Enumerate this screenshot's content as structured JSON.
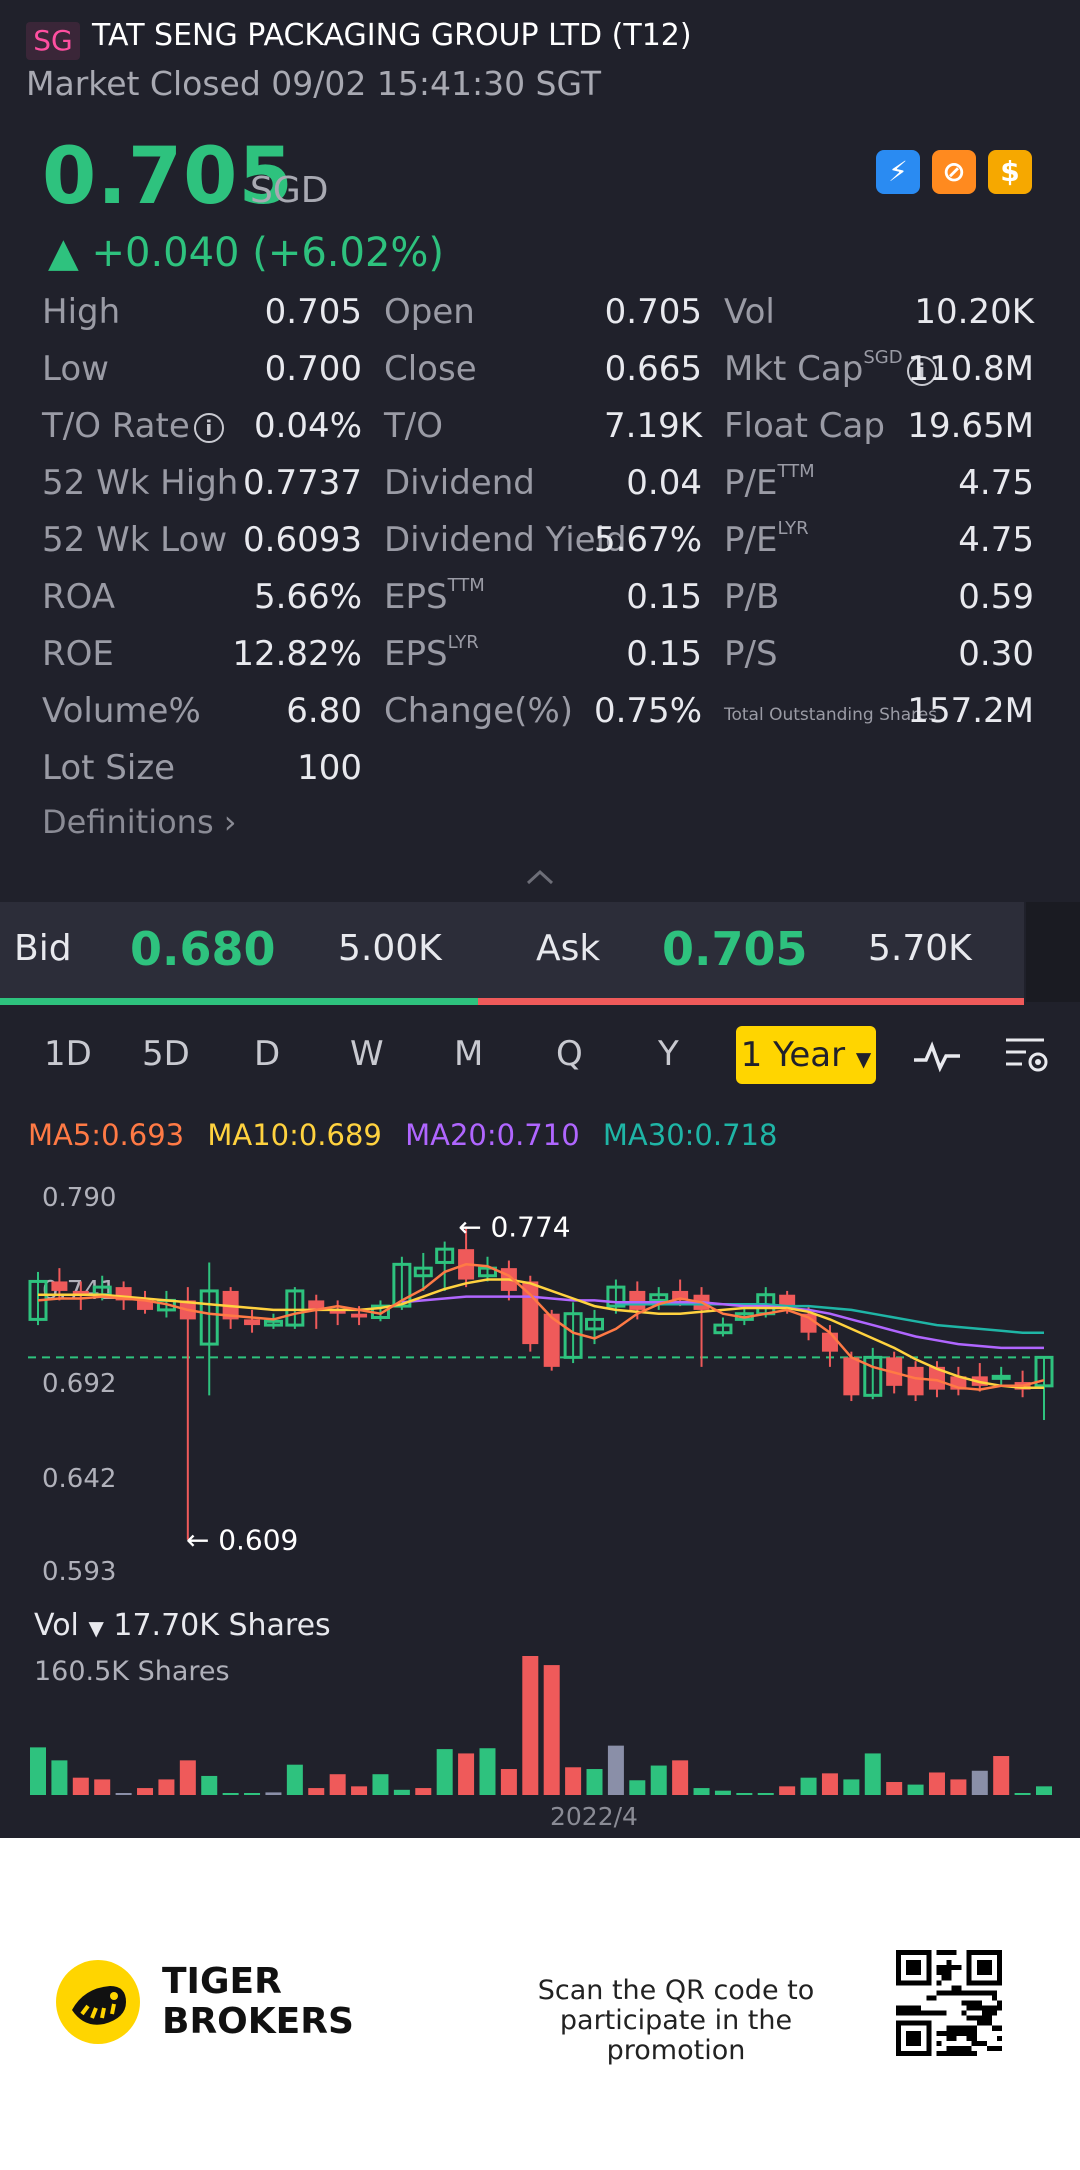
{
  "header": {
    "region": "SG",
    "stock_name": "TAT SENG PACKAGING GROUP LTD (T12)",
    "market_status": "Market Closed 09/02 15:41:30 SGT"
  },
  "quote": {
    "price": "0.705",
    "currency": "SGD",
    "change": "▲ +0.040 (+6.02%)"
  },
  "stats": {
    "col1": [
      {
        "label": "High",
        "value": "0.705"
      },
      {
        "label": "Low",
        "value": "0.700"
      },
      {
        "label": "T/O Rate",
        "value": "0.04%"
      },
      {
        "label": "52 Wk High",
        "value": "0.7737"
      },
      {
        "label": "52 Wk Low",
        "value": "0.6093"
      },
      {
        "label": "ROA",
        "value": "5.66%"
      },
      {
        "label": "ROE",
        "value": "12.82%"
      },
      {
        "label": "Volume%",
        "value": "6.80"
      },
      {
        "label": "Lot Size",
        "value": "100"
      }
    ],
    "col2": [
      {
        "label": "Open",
        "value": "0.705"
      },
      {
        "label": "Close",
        "value": "0.665"
      },
      {
        "label": "T/O",
        "value": "7.19K"
      },
      {
        "label": "Dividend",
        "value": "0.04"
      },
      {
        "label": "Dividend Yield",
        "value": "5.67%"
      },
      {
        "label": "EPS",
        "sup": "TTM",
        "value": "0.15"
      },
      {
        "label": "EPS",
        "sup": "LYR",
        "value": "0.15"
      },
      {
        "label": "Change(%)",
        "value": "0.75%"
      }
    ],
    "col3": [
      {
        "label": "Vol",
        "value": "10.20K"
      },
      {
        "label": "Mkt Cap",
        "sup": "SGD",
        "value": "110.8M"
      },
      {
        "label": "Float Cap",
        "value": "19.65M"
      },
      {
        "label": "P/E",
        "sup": "TTM",
        "value": "4.75"
      },
      {
        "label": "P/E",
        "sup": "LYR",
        "value": "4.75"
      },
      {
        "label": "P/B",
        "value": "0.59"
      },
      {
        "label": "P/S",
        "value": "0.30"
      },
      {
        "label": "Total Outstanding Shares",
        "value": "157.2M"
      }
    ],
    "definitions": "Definitions"
  },
  "bidask": {
    "bid_label": "Bid",
    "bid_price": "0.680",
    "bid_size": "5.00K",
    "ask_label": "Ask",
    "ask_price": "0.705",
    "ask_size": "5.70K"
  },
  "tabs": [
    "1D",
    "5D",
    "D",
    "W",
    "M",
    "Q",
    "Y"
  ],
  "active_tab": "1 Year",
  "ma": {
    "ma5": "MA5:0.693",
    "ma10": "MA10:0.689",
    "ma20": "MA20:0.710",
    "ma30": "MA30:0.718"
  },
  "colors": {
    "up": "#2ec27e",
    "down": "#ef5a5a",
    "ma5": "#ff7a45",
    "ma10": "#ffd23f",
    "ma20": "#b066ff",
    "ma30": "#1fb5a6",
    "neutral": "#8a8fa8"
  },
  "chart_data": {
    "type": "candlestick",
    "y_ticks": [
      "0.790",
      "0.741",
      "0.692",
      "0.642",
      "0.593"
    ],
    "ylim": [
      0.593,
      0.79
    ],
    "high_annotation": "0.774",
    "low_annotation": "0.609",
    "last_close": 0.705,
    "candles": [
      [
        0.725,
        0.745,
        0.75,
        0.722
      ],
      [
        0.745,
        0.74,
        0.752,
        0.735
      ],
      [
        0.74,
        0.738,
        0.745,
        0.73
      ],
      [
        0.738,
        0.742,
        0.748,
        0.735
      ],
      [
        0.742,
        0.735,
        0.745,
        0.73
      ],
      [
        0.735,
        0.73,
        0.74,
        0.728
      ],
      [
        0.73,
        0.735,
        0.74,
        0.726
      ],
      [
        0.735,
        0.725,
        0.742,
        0.609
      ],
      [
        0.712,
        0.74,
        0.755,
        0.685
      ],
      [
        0.74,
        0.725,
        0.742,
        0.72
      ],
      [
        0.725,
        0.722,
        0.73,
        0.718
      ],
      [
        0.722,
        0.724,
        0.728,
        0.72
      ],
      [
        0.722,
        0.74,
        0.742,
        0.72
      ],
      [
        0.735,
        0.73,
        0.738,
        0.72
      ],
      [
        0.73,
        0.728,
        0.735,
        0.722
      ],
      [
        0.728,
        0.726,
        0.732,
        0.722
      ],
      [
        0.726,
        0.732,
        0.735,
        0.724
      ],
      [
        0.732,
        0.754,
        0.758,
        0.73
      ],
      [
        0.748,
        0.752,
        0.76,
        0.74
      ],
      [
        0.755,
        0.762,
        0.766,
        0.74
      ],
      [
        0.762,
        0.746,
        0.774,
        0.742
      ],
      [
        0.748,
        0.752,
        0.758,
        0.745
      ],
      [
        0.752,
        0.74,
        0.756,
        0.735
      ],
      [
        0.745,
        0.712,
        0.748,
        0.708
      ],
      [
        0.728,
        0.7,
        0.73,
        0.698
      ],
      [
        0.705,
        0.728,
        0.734,
        0.702
      ],
      [
        0.72,
        0.725,
        0.73,
        0.712
      ],
      [
        0.732,
        0.742,
        0.746,
        0.728
      ],
      [
        0.74,
        0.73,
        0.745,
        0.725
      ],
      [
        0.735,
        0.738,
        0.742,
        0.73
      ],
      [
        0.74,
        0.735,
        0.746,
        0.732
      ],
      [
        0.738,
        0.73,
        0.742,
        0.7
      ],
      [
        0.718,
        0.722,
        0.726,
        0.716
      ],
      [
        0.725,
        0.728,
        0.732,
        0.722
      ],
      [
        0.728,
        0.738,
        0.742,
        0.726
      ],
      [
        0.738,
        0.732,
        0.74,
        0.728
      ],
      [
        0.728,
        0.718,
        0.732,
        0.714
      ],
      [
        0.718,
        0.708,
        0.722,
        0.7
      ],
      [
        0.705,
        0.685,
        0.708,
        0.682
      ],
      [
        0.685,
        0.705,
        0.71,
        0.683
      ],
      [
        0.705,
        0.69,
        0.708,
        0.686
      ],
      [
        0.7,
        0.685,
        0.703,
        0.682
      ],
      [
        0.7,
        0.688,
        0.703,
        0.684
      ],
      [
        0.695,
        0.688,
        0.7,
        0.685
      ],
      [
        0.695,
        0.69,
        0.702,
        0.687
      ],
      [
        0.695,
        0.695,
        0.7,
        0.69
      ],
      [
        0.692,
        0.688,
        0.698,
        0.684
      ],
      [
        0.69,
        0.705,
        0.705,
        0.672
      ]
    ],
    "ma": {
      "ma5": [
        0.735,
        0.736,
        0.736,
        0.737,
        0.736,
        0.735,
        0.733,
        0.73,
        0.728,
        0.727,
        0.726,
        0.725,
        0.728,
        0.73,
        0.732,
        0.73,
        0.728,
        0.735,
        0.741,
        0.75,
        0.754,
        0.753,
        0.748,
        0.738,
        0.726,
        0.718,
        0.715,
        0.72,
        0.728,
        0.733,
        0.736,
        0.734,
        0.728,
        0.726,
        0.728,
        0.73,
        0.726,
        0.718,
        0.705,
        0.7,
        0.697,
        0.694,
        0.693,
        0.689,
        0.688,
        0.69,
        0.69,
        0.693
      ],
      "ma10": [
        0.738,
        0.738,
        0.738,
        0.738,
        0.737,
        0.736,
        0.735,
        0.734,
        0.733,
        0.732,
        0.731,
        0.73,
        0.73,
        0.73,
        0.73,
        0.73,
        0.731,
        0.733,
        0.737,
        0.741,
        0.744,
        0.746,
        0.746,
        0.744,
        0.74,
        0.736,
        0.732,
        0.73,
        0.729,
        0.728,
        0.728,
        0.729,
        0.73,
        0.731,
        0.731,
        0.731,
        0.729,
        0.725,
        0.72,
        0.715,
        0.71,
        0.704,
        0.699,
        0.695,
        0.692,
        0.69,
        0.689,
        0.689
      ],
      "ma20": [
        null,
        null,
        null,
        null,
        null,
        null,
        null,
        null,
        null,
        null,
        null,
        null,
        null,
        null,
        null,
        null,
        null,
        0.734,
        0.735,
        0.736,
        0.737,
        0.737,
        0.737,
        0.737,
        0.736,
        0.735,
        0.735,
        0.734,
        0.734,
        0.734,
        0.734,
        0.734,
        0.733,
        0.732,
        0.732,
        0.731,
        0.73,
        0.728,
        0.725,
        0.722,
        0.719,
        0.716,
        0.714,
        0.712,
        0.711,
        0.71,
        0.71,
        0.71
      ],
      "ma30": [
        null,
        null,
        null,
        null,
        null,
        null,
        null,
        null,
        null,
        null,
        null,
        null,
        null,
        null,
        null,
        null,
        null,
        null,
        null,
        null,
        null,
        null,
        null,
        null,
        null,
        null,
        null,
        0.733,
        0.733,
        0.733,
        0.733,
        0.733,
        0.733,
        0.733,
        0.733,
        0.732,
        0.732,
        0.731,
        0.73,
        0.728,
        0.726,
        0.724,
        0.722,
        0.721,
        0.72,
        0.719,
        0.718,
        0.718
      ]
    }
  },
  "volume": {
    "label": "Vol",
    "current": "17.70K Shares",
    "max_label": "160.5K Shares",
    "max_value": 160.5,
    "date_label": "2022/4",
    "bars": [
      {
        "v": 55,
        "c": "up"
      },
      {
        "v": 40,
        "c": "up"
      },
      {
        "v": 20,
        "c": "down"
      },
      {
        "v": 18,
        "c": "down"
      },
      {
        "v": 2,
        "c": "neutral"
      },
      {
        "v": 8,
        "c": "down"
      },
      {
        "v": 18,
        "c": "down"
      },
      {
        "v": 40,
        "c": "down"
      },
      {
        "v": 22,
        "c": "up"
      },
      {
        "v": 0,
        "c": "up"
      },
      {
        "v": 0,
        "c": "up"
      },
      {
        "v": 3,
        "c": "neutral"
      },
      {
        "v": 35,
        "c": "up"
      },
      {
        "v": 8,
        "c": "down"
      },
      {
        "v": 24,
        "c": "down"
      },
      {
        "v": 10,
        "c": "down"
      },
      {
        "v": 24,
        "c": "up"
      },
      {
        "v": 6,
        "c": "up"
      },
      {
        "v": 8,
        "c": "down"
      },
      {
        "v": 53,
        "c": "up"
      },
      {
        "v": 48,
        "c": "down"
      },
      {
        "v": 54,
        "c": "up"
      },
      {
        "v": 30,
        "c": "down"
      },
      {
        "v": 160.5,
        "c": "down"
      },
      {
        "v": 150,
        "c": "down"
      },
      {
        "v": 32,
        "c": "down"
      },
      {
        "v": 30,
        "c": "up"
      },
      {
        "v": 57,
        "c": "neutral"
      },
      {
        "v": 17,
        "c": "up"
      },
      {
        "v": 34,
        "c": "up"
      },
      {
        "v": 40,
        "c": "down"
      },
      {
        "v": 8,
        "c": "up"
      },
      {
        "v": 5,
        "c": "up"
      },
      {
        "v": 0,
        "c": "up"
      },
      {
        "v": 0,
        "c": "up"
      },
      {
        "v": 10,
        "c": "down"
      },
      {
        "v": 20,
        "c": "up"
      },
      {
        "v": 25,
        "c": "down"
      },
      {
        "v": 18,
        "c": "up"
      },
      {
        "v": 48,
        "c": "up"
      },
      {
        "v": 15,
        "c": "down"
      },
      {
        "v": 12,
        "c": "up"
      },
      {
        "v": 26,
        "c": "down"
      },
      {
        "v": 18,
        "c": "down"
      },
      {
        "v": 28,
        "c": "neutral"
      },
      {
        "v": 45,
        "c": "down"
      },
      {
        "v": 0,
        "c": "up"
      },
      {
        "v": 10,
        "c": "up"
      }
    ]
  },
  "footer": {
    "brand_line1": "TIGER",
    "brand_line2": "BROKERS",
    "promo_line1": "Scan the QR code to",
    "promo_line2": "participate in the promotion"
  }
}
